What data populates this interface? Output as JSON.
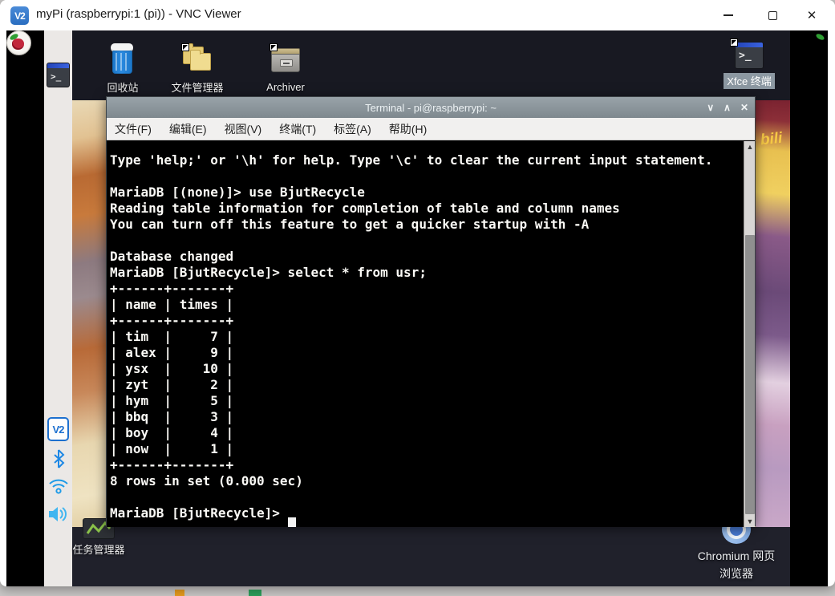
{
  "vnc_viewer": {
    "window_title": "myPi (raspberrypi:1 (pi)) - VNC Viewer",
    "logo_text": "V2",
    "close_glyph": "✕"
  },
  "sidebar": {
    "vnc_badge_text": "V2",
    "terminal_prompt_glyph": ">_"
  },
  "desktop": {
    "icons": [
      {
        "label": "回收站"
      },
      {
        "label": "文件管理器"
      },
      {
        "label": "Archiver"
      },
      {
        "label": "Xfce 终端"
      }
    ],
    "bottom_icons": {
      "task_manager_label": "任务管理器",
      "chromium_label_line1": "Chromium 网页",
      "chromium_label_line2": "浏览器"
    },
    "wallpaper_text": "bili"
  },
  "terminal": {
    "title": "Terminal - pi@raspberrypi: ~",
    "controls": {
      "rollup": "∨",
      "maximize": "∧",
      "close": "✕"
    },
    "menu": {
      "items": [
        {
          "label": "文件(F)"
        },
        {
          "label": "编辑(E)"
        },
        {
          "label": "视图(V)"
        },
        {
          "label": "终端(T)"
        },
        {
          "label": "标签(A)"
        },
        {
          "label": "帮助(H)"
        }
      ]
    },
    "icon_glyph": ">_",
    "output": "Type 'help;' or '\\h' for help. Type '\\c' to clear the current input statement.\n\nMariaDB [(none)]> use BjutRecycle\nReading table information for completion of table and column names\nYou can turn off this feature to get a quicker startup with -A\n\nDatabase changed\nMariaDB [BjutRecycle]> select * from usr;\n+------+-------+\n| name | times |\n+------+-------+\n| tim  |     7 |\n| alex |     9 |\n| ysx  |    10 |\n| zyt  |     2 |\n| hym  |     5 |\n| bbq  |     3 |\n| boy  |     4 |\n| now  |     1 |\n+------+-------+\n8 rows in set (0.000 sec)\n\nMariaDB [BjutRecycle]> ",
    "result_table": {
      "columns": [
        "name",
        "times"
      ],
      "rows": [
        [
          "tim",
          7
        ],
        [
          "alex",
          9
        ],
        [
          "ysx",
          10
        ],
        [
          "zyt",
          2
        ],
        [
          "hym",
          5
        ],
        [
          "bbq",
          3
        ],
        [
          "boy",
          4
        ],
        [
          "now",
          1
        ]
      ],
      "summary": "8 rows in set (0.000 sec)"
    },
    "colors": {
      "background": "#000000",
      "foreground": "#fbfaf6",
      "titlebar": "#8b959b"
    }
  }
}
